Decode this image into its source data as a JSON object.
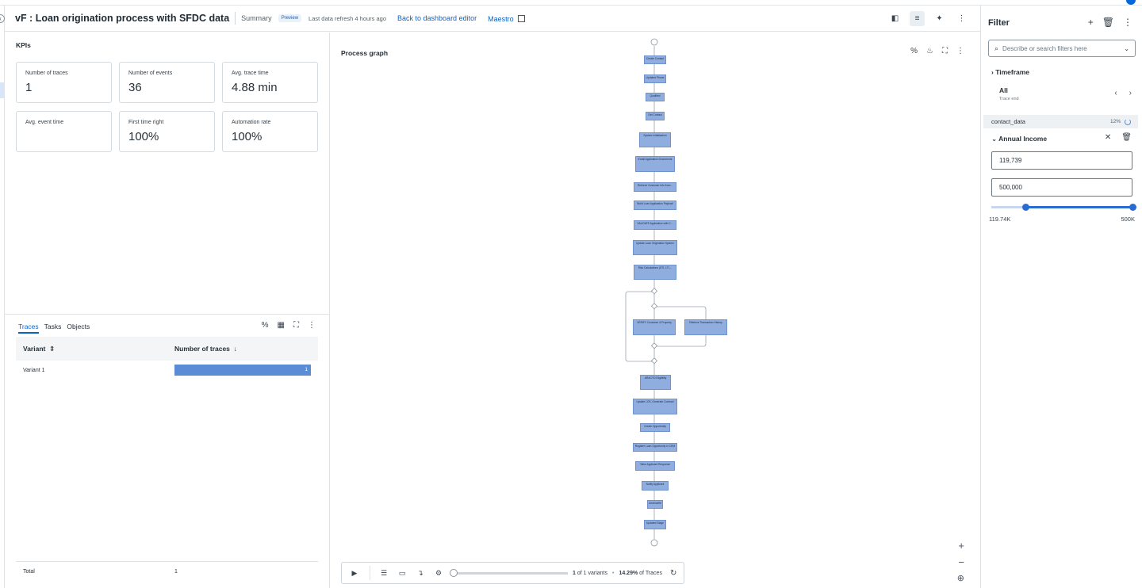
{
  "header": {
    "title": "vF : Loan origination process with SFDC data",
    "summary": "Summary",
    "badge": "Preview",
    "refresh": "Last data refresh 4 hours ago",
    "back_link": "Back to dashboard editor",
    "maestro_link": "Maestro"
  },
  "kpis": {
    "title": "KPIs",
    "cards": [
      {
        "label": "Number of traces",
        "value": "1"
      },
      {
        "label": "Number of events",
        "value": "36"
      },
      {
        "label": "Avg. trace time",
        "value": "4.88 min"
      },
      {
        "label": "Avg. event time",
        "value": ""
      },
      {
        "label": "First time right",
        "value": "100%"
      },
      {
        "label": "Automation rate",
        "value": "100%"
      }
    ]
  },
  "traces": {
    "tabs": [
      "Traces",
      "Tasks",
      "Objects"
    ],
    "columns": [
      "Variant",
      "Number of traces"
    ],
    "rows": [
      {
        "variant": "Variant 1",
        "count": "1"
      }
    ],
    "total_label": "Total",
    "total_value": "1"
  },
  "graph": {
    "title": "Process graph",
    "nodes": [
      "Create Contact",
      "Updated Phone",
      "Qualified",
      "Get Contact",
      "System Initialization",
      "Email Application Documents",
      "Retrieve Customer Info from...",
      "Build Loan Application Payload",
      "VALIDATE Application with C...",
      "Update Loan Origination System",
      "Risk Calculations (DTI, LTI,...",
      "VERIFY Customer & Property",
      "Retrieve Transaction History",
      "ARACYD Eligibility",
      "Update LOS, Generate Contract",
      "Create Opportunity",
      "Register Loan Opportunity in CRM",
      "Tailor Applicant Response",
      "Notify Applicant",
      "Underwrite",
      "Updated Stage"
    ],
    "player": {
      "variants_num": "1",
      "variants_text": "of 1 variants",
      "traces_pct": "14.29%",
      "traces_text": "of Traces"
    }
  },
  "filter": {
    "title": "Filter",
    "search_placeholder": "Describe or search filters here",
    "timeframe_label": "Timeframe",
    "timeframe_value": "All",
    "timeframe_sub": "Trace end",
    "datasource": "contact_data",
    "datasource_pct": "12%",
    "annual_income_label": "Annual Income",
    "min_value": "119,739",
    "max_value": "500,000",
    "range_min_label": "119.74K",
    "range_max_label": "500K",
    "range_selected_fraction": [
      0.22,
      1.0
    ]
  },
  "colors": {
    "accent": "#0b63c8",
    "node_fill": "#8fadde",
    "bar_fill": "#5b8dd6",
    "slider": "#2a6cd1"
  }
}
